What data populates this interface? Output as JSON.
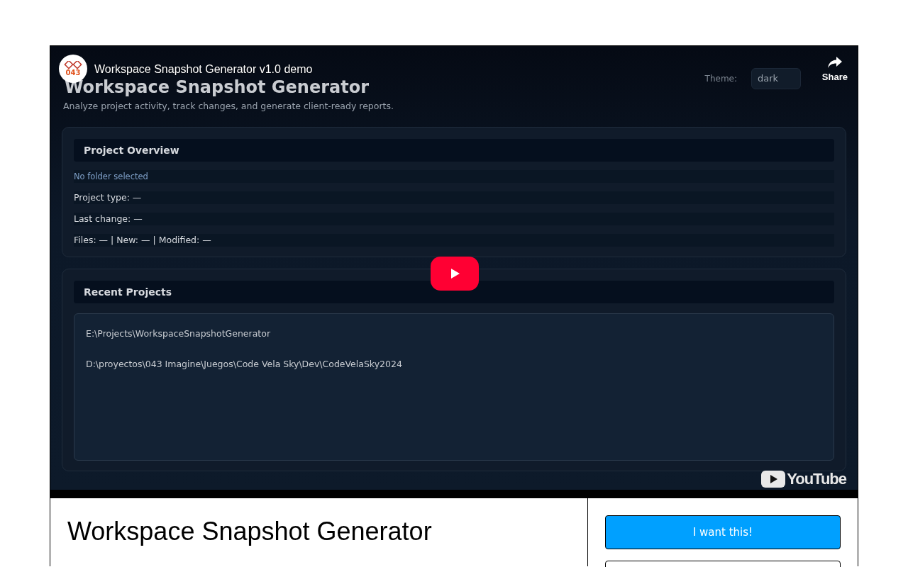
{
  "video": {
    "channel_logo": "043",
    "title": "Workspace Snapshot Generator v1.0 demo",
    "share_label": "Share",
    "brand": "YouTube",
    "app": {
      "heading": "Workspace Snapshot Generator",
      "subtitle": "Analyze project activity, track changes, and generate client-ready reports.",
      "theme_label": "Theme:",
      "theme_value": "dark",
      "sections": [
        {
          "title": "Project Overview",
          "kind": "rows",
          "rows": [
            {
              "text": "No folder selected",
              "kind": "status"
            },
            {
              "text": "Project type: —",
              "kind": "field"
            },
            {
              "text": "Last change: —",
              "kind": "field"
            },
            {
              "text": "Files: — | New: — | Modified: —",
              "kind": "field"
            }
          ]
        },
        {
          "title": "Recent Projects",
          "kind": "list",
          "rows": [
            {
              "text": "E:\\Projects\\WorkspaceSnapshotGenerator",
              "kind": "path"
            },
            {
              "text": "D:\\proyectos\\043 Imagine\\Juegos\\Code Vela Sky\\Dev\\CodeVelaSky2024",
              "kind": "path"
            }
          ]
        }
      ]
    }
  },
  "product": {
    "title": "Workspace Snapshot Generator"
  },
  "buttons": [
    {
      "label": "I want this!",
      "kind": "primary"
    },
    {
      "kind": "secondary"
    }
  ]
}
